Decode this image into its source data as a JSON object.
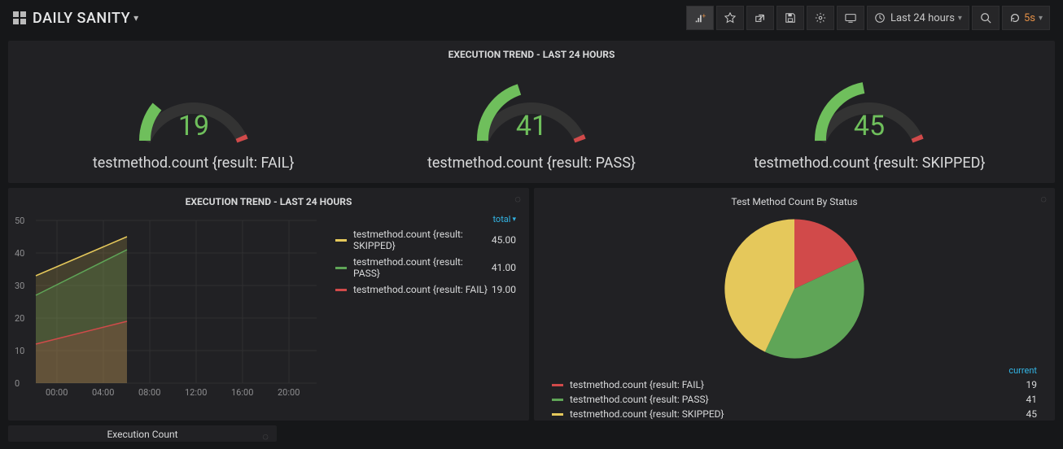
{
  "header": {
    "title": "DAILY SANITY",
    "time_range": "Last 24 hours",
    "refresh_interval": "5s"
  },
  "gauges": {
    "panel_title": "EXECUTION TREND - LAST 24 HOURS",
    "items": [
      {
        "value": "19",
        "label": "testmethod.count {result: FAIL}"
      },
      {
        "value": "41",
        "label": "testmethod.count {result: PASS}"
      },
      {
        "value": "45",
        "label": "testmethod.count {result: SKIPPED}"
      }
    ]
  },
  "trend": {
    "title": "EXECUTION TREND - LAST 24 HOURS",
    "legend_header": "total",
    "series": [
      {
        "name": "testmethod.count {result: SKIPPED}",
        "value": "45.00",
        "color": "#e5c85b"
      },
      {
        "name": "testmethod.count {result: PASS}",
        "value": "41.00",
        "color": "#5fa557"
      },
      {
        "name": "testmethod.count {result: FAIL}",
        "value": "19.00",
        "color": "#d14a4a"
      }
    ],
    "y_ticks": [
      "0",
      "10",
      "20",
      "30",
      "40",
      "50"
    ],
    "x_ticks": [
      "00:00",
      "04:00",
      "08:00",
      "12:00",
      "16:00",
      "20:00"
    ]
  },
  "pie": {
    "title": "Test Method Count By Status",
    "legend_header": "current",
    "slices": [
      {
        "name": "testmethod.count {result: FAIL}",
        "value": "19",
        "color": "#d14a4a"
      },
      {
        "name": "testmethod.count {result: PASS}",
        "value": "41",
        "color": "#5fa557"
      },
      {
        "name": "testmethod.count {result: SKIPPED}",
        "value": "45",
        "color": "#e5c85b"
      }
    ]
  },
  "exec_count": {
    "title": "Execution Count"
  },
  "chart_data": [
    {
      "type": "gauge",
      "title": "EXECUTION TREND - LAST 24 HOURS",
      "series": [
        {
          "name": "testmethod.count {result: FAIL}",
          "value": 19
        },
        {
          "name": "testmethod.count {result: PASS}",
          "value": 41
        },
        {
          "name": "testmethod.count {result: SKIPPED}",
          "value": 45
        }
      ],
      "range": [
        0,
        100
      ]
    },
    {
      "type": "area",
      "title": "EXECUTION TREND - LAST 24 HOURS",
      "x": [
        "00:00",
        "04:00",
        "08:00",
        "12:00",
        "16:00",
        "20:00"
      ],
      "ylim": [
        0,
        50
      ],
      "series": [
        {
          "name": "testmethod.count {result: SKIPPED}",
          "total": 45.0,
          "start": 33,
          "end_at_06:00": 45
        },
        {
          "name": "testmethod.count {result: PASS}",
          "total": 41.0,
          "start": 27,
          "end_at_06:00": 41
        },
        {
          "name": "testmethod.count {result: FAIL}",
          "total": 19.0,
          "start": 12,
          "end_at_06:00": 19
        }
      ]
    },
    {
      "type": "pie",
      "title": "Test Method Count By Status",
      "categories": [
        "FAIL",
        "PASS",
        "SKIPPED"
      ],
      "values": [
        19,
        41,
        45
      ]
    }
  ]
}
